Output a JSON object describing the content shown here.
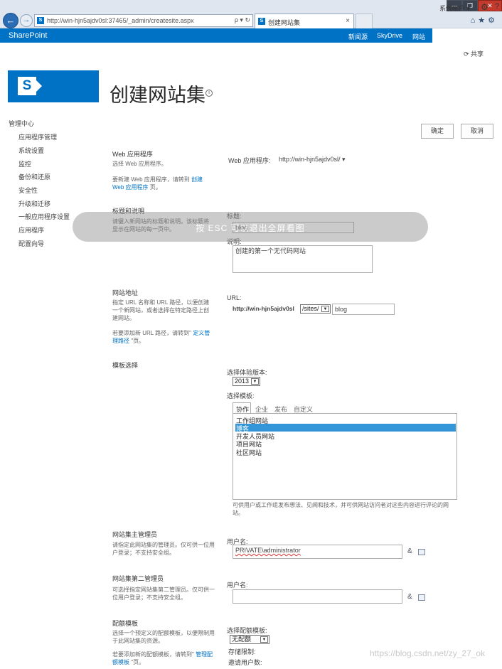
{
  "browser": {
    "url": "http://win-hjn5ajdv0sl:37465/_admin/createsite.aspx",
    "tab_title": "创建网站集",
    "tab_close": "×",
    "addr_icons": "ρ ▾ ↻",
    "win_min": "—",
    "win_max": "❐",
    "win_close": "✕",
    "tools": "⌂★⚙"
  },
  "suitebar": {
    "brand": "SharePoint",
    "newsfeed": "新闻源",
    "skydrive": "SkyDrive",
    "sites": "网站",
    "user": "系统帐户 ▾",
    "gear": "⚙",
    "help": "?",
    "share": "⟳ 共享"
  },
  "page": {
    "title": "创建网站集",
    "info": "i"
  },
  "nav": {
    "root": "管理中心",
    "items": [
      "应用程序管理",
      "系统设置",
      "监控",
      "备份和还原",
      "安全性",
      "升级和迁移",
      "一般应用程序设置",
      "应用程序",
      "配置向导"
    ]
  },
  "buttons": {
    "ok": "确定",
    "cancel": "取消"
  },
  "webapp": {
    "title": "Web 应用程序",
    "desc1": "选择 Web 应用程序。",
    "desc2_pre": "要新建 Web 应用程序，请转到 ",
    "desc2_link": "创建 Web 应用程序",
    "desc2_post": " 页。",
    "label": "Web 应用程序:",
    "value": "http://win-hjn5ajdv0sl/ ▾"
  },
  "titledesc": {
    "title": "标题和说明",
    "desc": "请键入新网站的标题和说明。该标题将显示在网站的每一页中。",
    "title_label": "标题:",
    "title_value": "blog",
    "desc_label": "说明:",
    "desc_value": "创建的第一个无代码网站"
  },
  "siteaddr": {
    "title": "网站地址",
    "desc1": "指定 URL 名称和 URL 路径，以便创建一个新网站，或者选择在特定路径上创建网站。",
    "desc2_pre": "若要添加新 URL 路径，请转到\" ",
    "desc2_link": "定义管理路径",
    "desc2_post": " \"页。",
    "url_label": "URL:",
    "url_prefix": "http://win-hjn5ajdv0sl",
    "path_select": "/sites/",
    "url_value": "blog"
  },
  "template": {
    "title": "模板选择",
    "version_label": "选择体验版本:",
    "version": "2013",
    "template_label": "选择模板:",
    "tabs": [
      "协作",
      "企业",
      "发布",
      "自定义"
    ],
    "items": [
      "工作组网站",
      "博客",
      "开发人员网站",
      "项目网站",
      "社区网站"
    ],
    "selected_index": 1,
    "desc": "可供用户或工作组发布想法、见闻和技术，并可供网站访问者对这些内容进行评论的网站。"
  },
  "primaryadmin": {
    "title": "网站集主管理员",
    "desc": "请指定此网站集的管理员。仅可供一位用户登录；不支持安全组。",
    "label": "用户名:",
    "value": "PRIVATE\\administrator"
  },
  "secondaryadmin": {
    "title": "网站集第二管理员",
    "desc": "可选择指定网站集第二管理员。仅可供一位用户登录；不支持安全组。",
    "label": "用户名:",
    "value": ""
  },
  "quota": {
    "title": "配额模板",
    "desc1": "选择一个预定义的配额模板，以便限制用于此网站集的资源。",
    "desc2_pre": "若要添加新的配额模板，请转到\" ",
    "desc2_link": "管理配额模板",
    "desc2_post": " \"页。",
    "select_label": "选择配额模板:",
    "select_value": "无配额",
    "storage_label": "存储限制:",
    "invite_label": "邀请用户数:"
  },
  "overlay": {
    "text": "按 ESC 可以退出全屏看图"
  },
  "watermark": "https://blog.csdn.net/zy_27_ok",
  "icons": {
    "people": "&",
    "book": "book-icon"
  }
}
